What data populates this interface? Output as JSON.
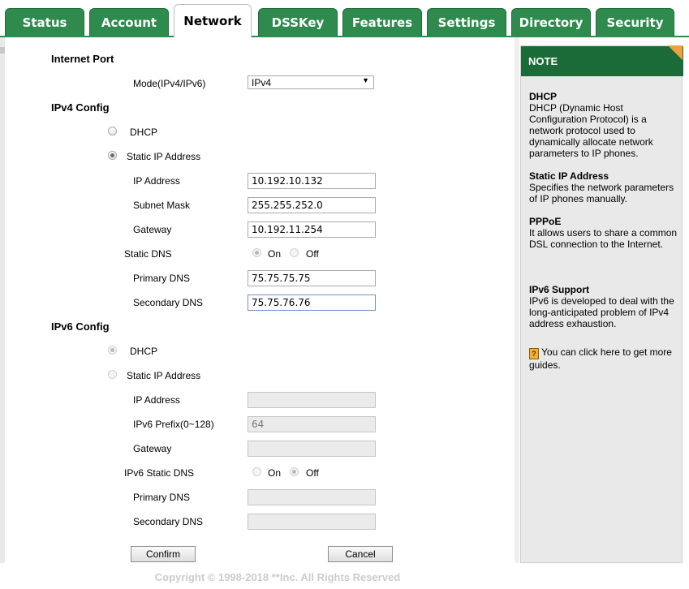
{
  "tabs": [
    {
      "label": "Status",
      "active": false
    },
    {
      "label": "Account",
      "active": false
    },
    {
      "label": "Network",
      "active": true
    },
    {
      "label": "DSSKey",
      "active": false
    },
    {
      "label": "Features",
      "active": false
    },
    {
      "label": "Settings",
      "active": false
    },
    {
      "label": "Directory",
      "active": false
    },
    {
      "label": "Security",
      "active": false
    }
  ],
  "internet_port": {
    "section_title": "Internet Port",
    "mode_label": "Mode(IPv4/IPv6)",
    "mode_value": "IPv4"
  },
  "ipv4": {
    "section_title": "IPv4 Config",
    "dhcp_label": "DHCP",
    "static_label": "Static IP Address",
    "selected": "static",
    "ip_label": "IP Address",
    "ip_value": "10.192.10.132",
    "mask_label": "Subnet Mask",
    "mask_value": "255.255.252.0",
    "gateway_label": "Gateway",
    "gateway_value": "10.192.11.254",
    "static_dns_label": "Static DNS",
    "on_label": "On",
    "off_label": "Off",
    "static_dns_value": "On",
    "primary_dns_label": "Primary DNS",
    "primary_dns_value": "75.75.75.75",
    "secondary_dns_label": "Secondary DNS",
    "secondary_dns_value": "75.75.76.76"
  },
  "ipv6": {
    "section_title": "IPv6 Config",
    "dhcp_label": "DHCP",
    "static_label": "Static IP Address",
    "selected": "dhcp",
    "ip_label": "IP Address",
    "ip_value": "",
    "prefix_label": "IPv6 Prefix(0~128)",
    "prefix_value": "64",
    "gateway_label": "Gateway",
    "gateway_value": "",
    "static_dns_label": "IPv6 Static DNS",
    "on_label": "On",
    "off_label": "Off",
    "static_dns_value": "Off",
    "primary_dns_label": "Primary DNS",
    "primary_dns_value": "",
    "secondary_dns_label": "Secondary DNS",
    "secondary_dns_value": ""
  },
  "buttons": {
    "confirm": "Confirm",
    "cancel": "Cancel"
  },
  "note": {
    "title": "NOTE",
    "dhcp_title": "DHCP",
    "dhcp_text": "DHCP (Dynamic Host Configuration Protocol) is a network protocol used to dynamically allocate network parameters to IP phones.",
    "static_title": "Static IP Address",
    "static_text": "Specifies the network parameters of IP phones manually.",
    "pppoe_title": "PPPoE",
    "pppoe_text": "It allows users to share a common DSL connection to the Internet.",
    "ipv6_title": "IPv6 Support",
    "ipv6_text": "IPv6 is developed to deal with the long-anticipated problem of IPv4 address exhaustion.",
    "guide_text": "You can click here to get more guides.",
    "guide_icon": "help-book-icon"
  },
  "footer": "Copyright © 1998-2018 **Inc. All Rights Reserved",
  "colors": {
    "tab_green": "#2f8a4e",
    "note_header": "#1b6b38",
    "note_fold": "#f0a13c"
  }
}
